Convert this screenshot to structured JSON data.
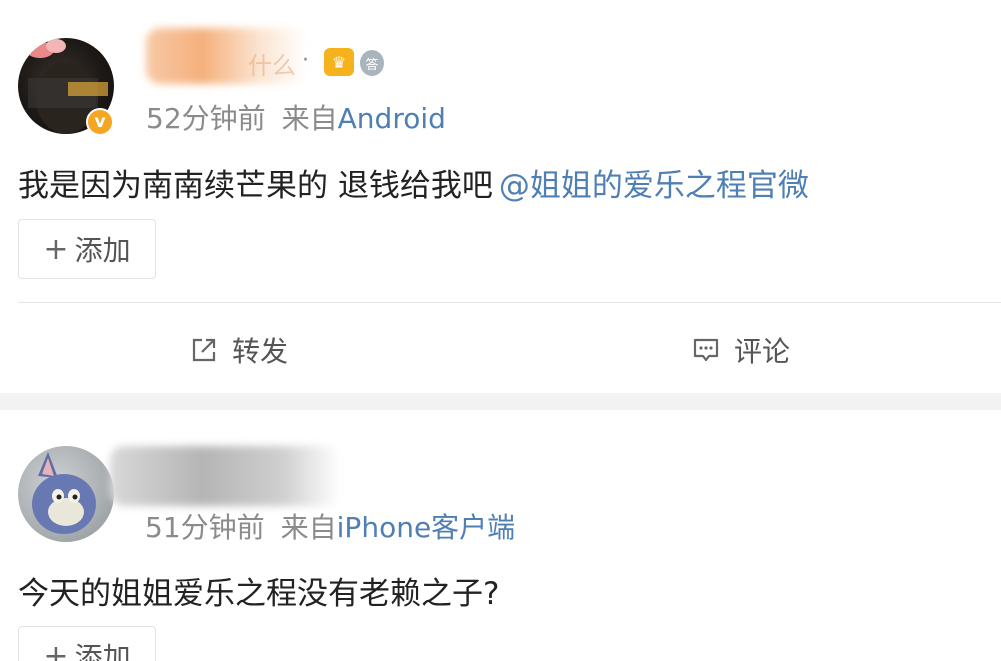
{
  "posts": [
    {
      "author_name_tail": "什么",
      "name_separator": "·",
      "avatar_badge": "v",
      "crown_badge": "♛",
      "medal_badge": "答",
      "time": "52分钟前",
      "from_label": "来自",
      "source": "Android",
      "text": "我是因为南南续芒果的 退钱给我吧",
      "mention": "@姐姐的爱乐之程官微",
      "add_label": "添加",
      "add_icon": "+",
      "repost_label": "转发",
      "comment_label": "评论"
    },
    {
      "time": "51分钟前",
      "from_label": "来自",
      "source": "iPhone客户端",
      "text": "今天的姐姐爱乐之程没有老赖之子?",
      "add_label": "添加",
      "add_icon": "+"
    }
  ],
  "colors": {
    "link": "#4f7fb3",
    "meta": "#8b8b8b",
    "text": "#222222",
    "separator": "#f2f2f2",
    "vip_badge": "#f5a623"
  },
  "icons": {
    "repost": "repost-icon",
    "comment": "comment-icon",
    "add": "plus-icon"
  }
}
